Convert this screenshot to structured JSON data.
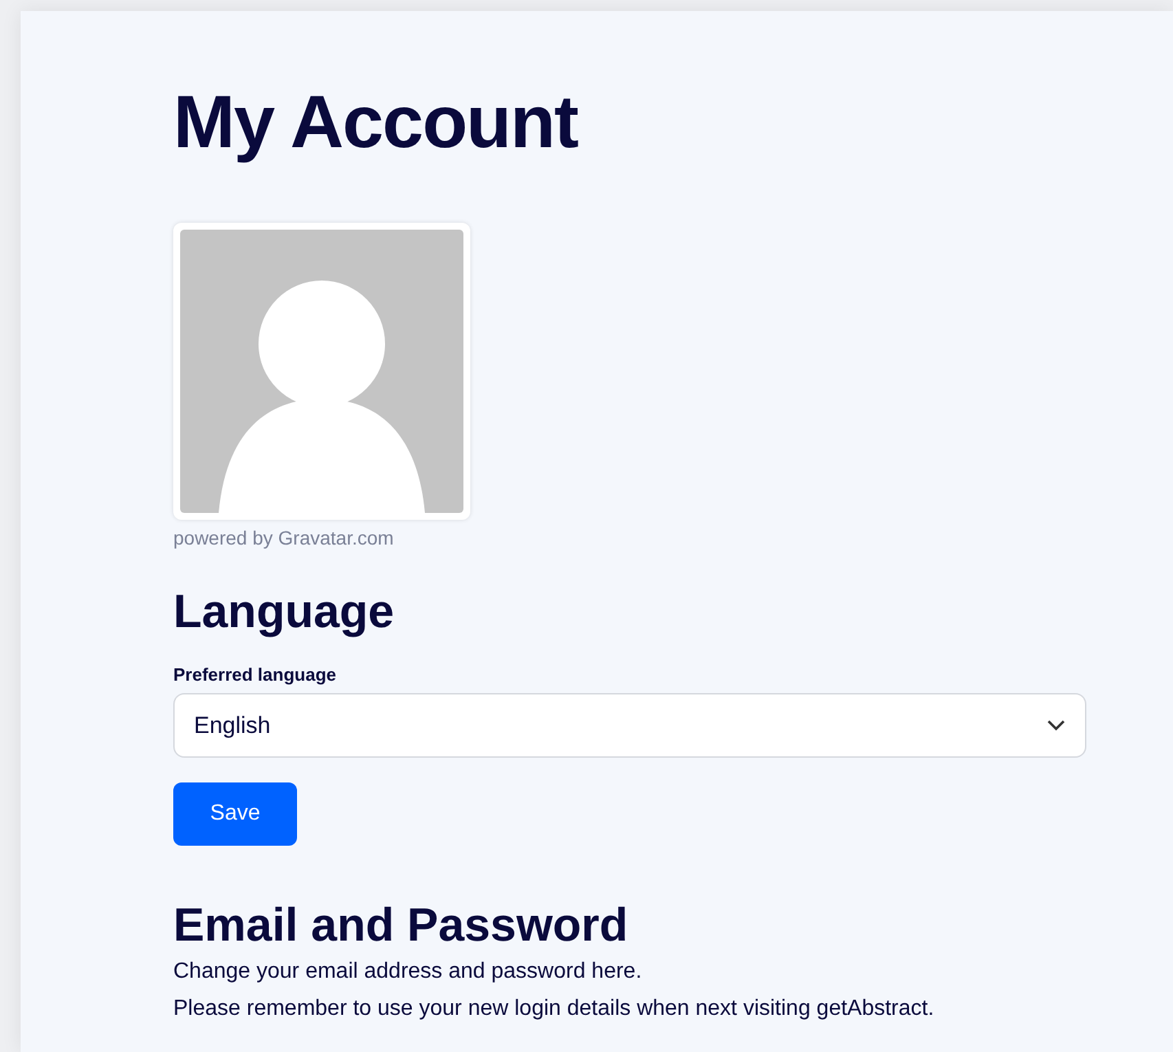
{
  "title": "My Account",
  "avatar": {
    "caption": "powered by Gravatar.com"
  },
  "language_section": {
    "heading": "Language",
    "field": {
      "label": "Preferred language",
      "value": "English"
    },
    "button": "Save"
  },
  "email_section": {
    "heading": "Email and Password",
    "lines": [
      "Change your email address and password here.",
      "Please remember to use your new login details when next visiting getAbstract."
    ]
  }
}
